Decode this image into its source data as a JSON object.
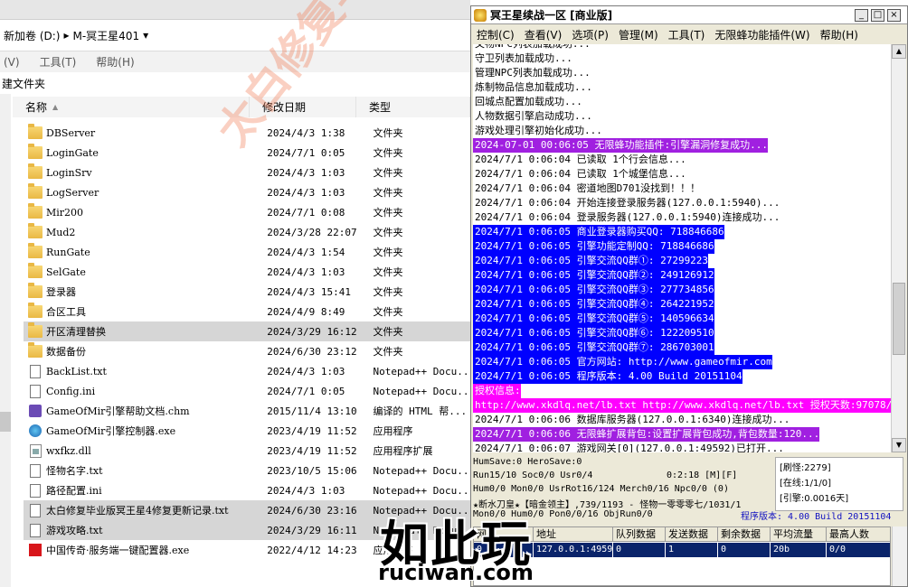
{
  "explorer": {
    "address": [
      "新加卷 (D:)",
      "▸",
      "M-冥王星401",
      "▾"
    ],
    "menu": [
      "(V)",
      "工具(T)",
      "帮助(H)"
    ],
    "toolbar_new_folder": "建文件夹",
    "columns": {
      "name": "名称",
      "date": "修改日期",
      "type": "类型"
    },
    "files": [
      {
        "name": "DBServer",
        "date": "2024/4/3 1:38",
        "type": "文件夹",
        "icon": "folder"
      },
      {
        "name": "LoginGate",
        "date": "2024/7/1 0:05",
        "type": "文件夹",
        "icon": "folder"
      },
      {
        "name": "LoginSrv",
        "date": "2024/4/3 1:03",
        "type": "文件夹",
        "icon": "folder"
      },
      {
        "name": "LogServer",
        "date": "2024/4/3 1:03",
        "type": "文件夹",
        "icon": "folder"
      },
      {
        "name": "Mir200",
        "date": "2024/7/1 0:08",
        "type": "文件夹",
        "icon": "folder"
      },
      {
        "name": "Mud2",
        "date": "2024/3/28 22:07",
        "type": "文件夹",
        "icon": "folder"
      },
      {
        "name": "RunGate",
        "date": "2024/4/3 1:54",
        "type": "文件夹",
        "icon": "folder"
      },
      {
        "name": "SelGate",
        "date": "2024/4/3 1:03",
        "type": "文件夹",
        "icon": "folder"
      },
      {
        "name": "登录器",
        "date": "2024/4/3 15:41",
        "type": "文件夹",
        "icon": "folder"
      },
      {
        "name": "合区工具",
        "date": "2024/4/9 8:49",
        "type": "文件夹",
        "icon": "folder"
      },
      {
        "name": "开区清理替换",
        "date": "2024/3/29 16:12",
        "type": "文件夹",
        "icon": "folder",
        "selected": true
      },
      {
        "name": "数据备份",
        "date": "2024/6/30 23:12",
        "type": "文件夹",
        "icon": "folder"
      },
      {
        "name": "BackList.txt",
        "date": "2024/4/3 1:03",
        "type": "Notepad++ Docu...",
        "icon": "file"
      },
      {
        "name": "Config.ini",
        "date": "2024/7/1 0:05",
        "type": "Notepad++ Docu...",
        "icon": "file"
      },
      {
        "name": "GameOfMir引擎帮助文档.chm",
        "date": "2015/11/4 13:10",
        "type": "编译的 HTML 帮...",
        "icon": "chm"
      },
      {
        "name": "GameOfMir引擎控制器.exe",
        "date": "2023/4/19 11:52",
        "type": "应用程序",
        "icon": "exe"
      },
      {
        "name": "wxfkz.dll",
        "date": "2023/4/19 11:52",
        "type": "应用程序扩展",
        "icon": "dll"
      },
      {
        "name": "怪物名字.txt",
        "date": "2023/10/5 15:06",
        "type": "Notepad++ Docu...",
        "icon": "file"
      },
      {
        "name": "路径配置.ini",
        "date": "2024/4/3 1:03",
        "type": "Notepad++ Docu...",
        "icon": "file"
      },
      {
        "name": "太白修复毕业版冥王星4修复更新记录.txt",
        "date": "2024/6/30 23:16",
        "type": "Notepad++ Docu...",
        "icon": "file",
        "selected": true
      },
      {
        "name": "游戏攻略.txt",
        "date": "2024/3/29 16:11",
        "type": "Notepad++ Docu...",
        "icon": "file",
        "selected": true
      },
      {
        "name": "中国传奇·服务端一键配置器.exe",
        "date": "2022/4/12 14:23",
        "type": "应用程序",
        "icon": "flag"
      }
    ]
  },
  "game": {
    "title": "冥王星续战一区 [商业版]",
    "menu": [
      "控制(C)",
      "查看(V)",
      "选项(P)",
      "管理(M)",
      "工具(T)",
      "无限蜂功能插件(W)",
      "帮助(H)"
    ],
    "log": [
      {
        "text": "文物NPC列表加载成功...",
        "hl": ""
      },
      {
        "text": "守卫列表加载成功...",
        "hl": ""
      },
      {
        "text": "管理NPC列表加载成功...",
        "hl": ""
      },
      {
        "text": "炼制物品信息加载成功...",
        "hl": ""
      },
      {
        "text": "回城点配置加载成功...",
        "hl": ""
      },
      {
        "text": "人物数据引擎启动成功...",
        "hl": ""
      },
      {
        "text": "游戏处理引擎初始化成功...",
        "hl": ""
      },
      {
        "text": "2024-07-01 00:06:05 无限蜂功能插件:引擎漏洞修复成功...",
        "hl": "purple"
      },
      {
        "text": "2024/7/1 0:06:04 已读取 1个行会信息...",
        "hl": ""
      },
      {
        "text": "2024/7/1 0:06:04 已读取 1个城堡信息...",
        "hl": ""
      },
      {
        "text": "2024/7/1 0:06:04 密道地图D701没找到！！！",
        "hl": ""
      },
      {
        "text": "2024/7/1 0:06:04 开始连接登录服务器(127.0.0.1:5940)...",
        "hl": ""
      },
      {
        "text": "2024/7/1 0:06:04 登录服务器(127.0.0.1:5940)连接成功...",
        "hl": ""
      },
      {
        "text": "2024/7/1 0:06:05 商业登录器购买QQ: 718846686",
        "hl": "blue"
      },
      {
        "text": "2024/7/1 0:06:05 引擎功能定制QQ: 718846686",
        "hl": "blue"
      },
      {
        "text": "2024/7/1 0:06:05 引擎交流QQ群①: 27299223",
        "hl": "blue"
      },
      {
        "text": "2024/7/1 0:06:05 引擎交流QQ群②: 249126912",
        "hl": "blue"
      },
      {
        "text": "2024/7/1 0:06:05 引擎交流QQ群③: 277734856",
        "hl": "blue"
      },
      {
        "text": "2024/7/1 0:06:05 引擎交流QQ群④: 264221952",
        "hl": "blue"
      },
      {
        "text": "2024/7/1 0:06:05 引擎交流QQ群⑤: 140596634",
        "hl": "blue"
      },
      {
        "text": "2024/7/1 0:06:05 引擎交流QQ群⑥: 122209510",
        "hl": "blue"
      },
      {
        "text": "2024/7/1 0:06:05 引擎交流QQ群⑦: 286703001",
        "hl": "blue"
      },
      {
        "text": "2024/7/1 0:06:05 官方网站: http://www.gameofmir.com",
        "hl": "blue"
      },
      {
        "text": "2024/7/1 0:06:05 程序版本: 4.00 Build 20151104",
        "hl": "blue"
      },
      {
        "text": "授权信息:",
        "hl": "magenta"
      },
      {
        "text": "http://www.xkdlq.net/lb.txt http://www.xkdlq.net/lb.txt 授权天数:97078/99999",
        "hl": "magenta"
      },
      {
        "text": "2024/7/1 0:06:06 数据库服务器(127.0.0.1:6340)连接成功...",
        "hl": ""
      },
      {
        "text": "2024/7/1 0:06:06 无限蜂扩展背包:设置扩展背包成功,背包数量:120...",
        "hl": "purple"
      },
      {
        "text": "2024/7/1 0:06:07 游戏网关[0](127.0.0.1:49592)已打开...",
        "hl": ""
      }
    ],
    "status": {
      "line1": "HumSave:0 HeroSave:0",
      "line2": "Run15/10 Soc0/0 Usr0/4",
      "time": "0:2:18 [M][F]",
      "line3": "Hum0/0 Mon0/0 UsrRot16/124 Merch0/16 Npc0/0 (0)",
      "line4": "★断水刀皇★【暗金领主】,739/1193 - 怪物一零零零七/1031/1",
      "line5": "Mon0/0 Hum0/0 Pon0/0/16 ObjRun0/0",
      "refresh": "[刷怪:2279]",
      "online": "[在线:1/1/0]",
      "engine": "[引擎:0.0016天]",
      "version": "程序版本: 4.00 Build 20151104"
    },
    "table": {
      "headers": [
        "网关",
        "地址",
        "队列数据",
        "发送数据",
        "剩余数据",
        "平均流量",
        "最高人数"
      ],
      "row": [
        "0",
        "127.0.0.1:49592",
        "0",
        "1",
        "0",
        "20b",
        "0/0"
      ]
    }
  },
  "watermarks": {
    "diagonal": "太白修复毕业版  QQ:1706",
    "logo": "如此玩",
    "url": "ruciwan.com"
  }
}
